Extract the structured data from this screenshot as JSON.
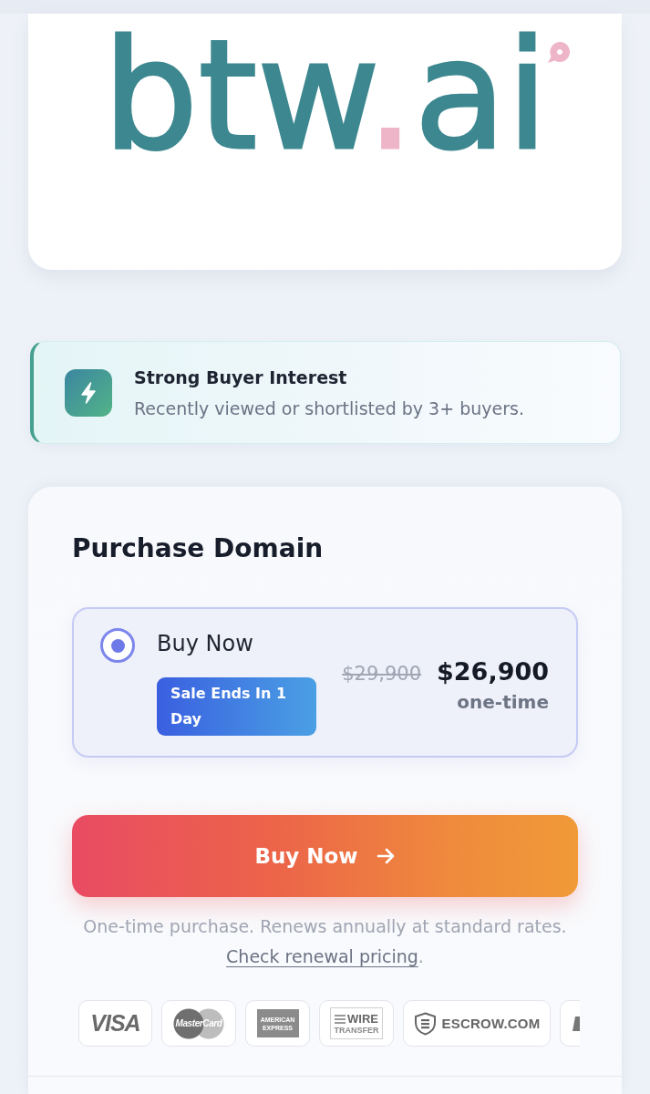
{
  "logo": {
    "parts": [
      {
        "text": "btw",
        "color": "#3d8890"
      },
      {
        "text": ".",
        "color": "#eeb5c9"
      },
      {
        "text": "ai",
        "color": "#3d8890"
      }
    ]
  },
  "interest_banner": {
    "title": "Strong Buyer Interest",
    "text": "Recently viewed or shortlisted by 3+ buyers."
  },
  "purchase": {
    "title": "Purchase Domain",
    "options": [
      {
        "label": "Buy Now",
        "selected": true,
        "badge": "Sale Ends In 1 Day",
        "old_price": "$29,900",
        "price": "$26,900",
        "term": "one-time"
      }
    ],
    "button": "Buy Now",
    "note": "One-time purchase. Renews annually at standard rates.",
    "link": "Check renewal pricing",
    "link_suffix": ".",
    "payment_methods": [
      {
        "kind": "visa",
        "text": "VISA"
      },
      {
        "kind": "mastercard",
        "text": "MasterCard"
      },
      {
        "kind": "amex",
        "text": "AMERICAN EXPRESS"
      },
      {
        "kind": "wire",
        "lines": [
          "WIRE",
          "TRANSFER"
        ]
      },
      {
        "kind": "escrow",
        "text": "ESCROW.COM"
      },
      {
        "kind": "partial"
      }
    ]
  }
}
